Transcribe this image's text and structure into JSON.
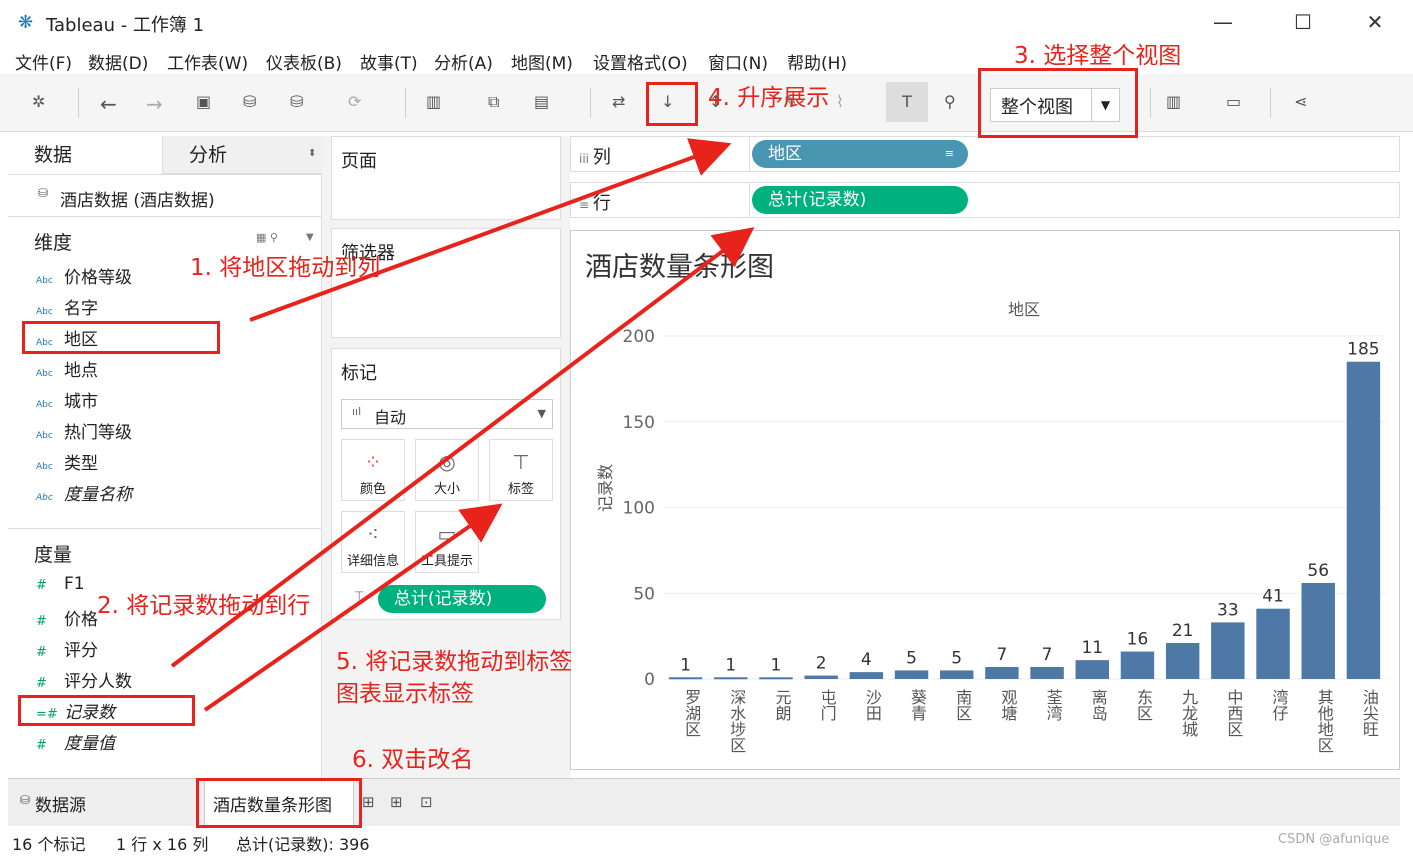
{
  "window": {
    "logo": "tableau-logo-icon",
    "title": "Tableau - 工作簿 1",
    "minimize": "—",
    "maximize": "☐",
    "close": "✕"
  },
  "menu": [
    "文件(F)",
    "数据(D)",
    "工作表(W)",
    "仪表板(B)",
    "故事(T)",
    "分析(A)",
    "地图(M)",
    "设置格式(O)",
    "窗口(N)",
    "帮助(H)"
  ],
  "toolbar": {
    "fit_value": "整个视图"
  },
  "left": {
    "tab_data": "数据",
    "tab_analysis": "分析",
    "datasource": "酒店数据 (酒店数据)",
    "dimensions_title": "维度",
    "dimensions": [
      "价格等级",
      "名字",
      "地区",
      "地点",
      "城市",
      "热门等级",
      "类型",
      "度量名称"
    ],
    "measures_title": "度量",
    "measures": [
      "F1",
      "价格",
      "评分",
      "评分人数",
      "记录数",
      "度量值"
    ]
  },
  "mid": {
    "pages": "页面",
    "filters": "筛选器",
    "marks": "标记",
    "mark_type": "自动",
    "mark_buttons": [
      "颜色",
      "大小",
      "标签",
      "详细信息",
      "工具提示"
    ],
    "label_pill": "总计(记录数)"
  },
  "shelves": {
    "columns_label": "列",
    "rows_label": "行",
    "columns_pill": "地区",
    "rows_pill": "总计(记录数)"
  },
  "chart_data": {
    "type": "bar",
    "title": "酒店数量条形图",
    "xlabel": "地区",
    "ylabel": "记录数",
    "ylim": [
      0,
      200
    ],
    "yticks": [
      0,
      50,
      100,
      150,
      200
    ],
    "categories": [
      "罗湖区",
      "深水埗区",
      "元朗",
      "屯门",
      "沙田",
      "葵青",
      "南区",
      "观塘",
      "荃湾",
      "离岛",
      "东区",
      "九龙城",
      "中西区",
      "湾仔",
      "其他地区",
      "油尖旺"
    ],
    "values": [
      1,
      1,
      1,
      2,
      4,
      5,
      5,
      7,
      7,
      11,
      16,
      21,
      33,
      41,
      56,
      185
    ],
    "color": "#4e79a7"
  },
  "bottom": {
    "datasource_tab": "数据源",
    "sheet_tab": "酒店数量条形图"
  },
  "status": {
    "marks": "16 个标记",
    "dims": "1 行 x 16 列",
    "sum": "总计(记录数): 396",
    "watermark": "CSDN @afunique"
  },
  "annotations": {
    "a1": "1. 将地区拖动到列",
    "a2": "2. 将记录数拖动到行",
    "a3": "3. 选择整个视图",
    "a4": "4. 升序展示",
    "a5a": "5. 将记录数拖动到标签",
    "a5b": "图表显示标签",
    "a6": "6. 双击改名"
  }
}
